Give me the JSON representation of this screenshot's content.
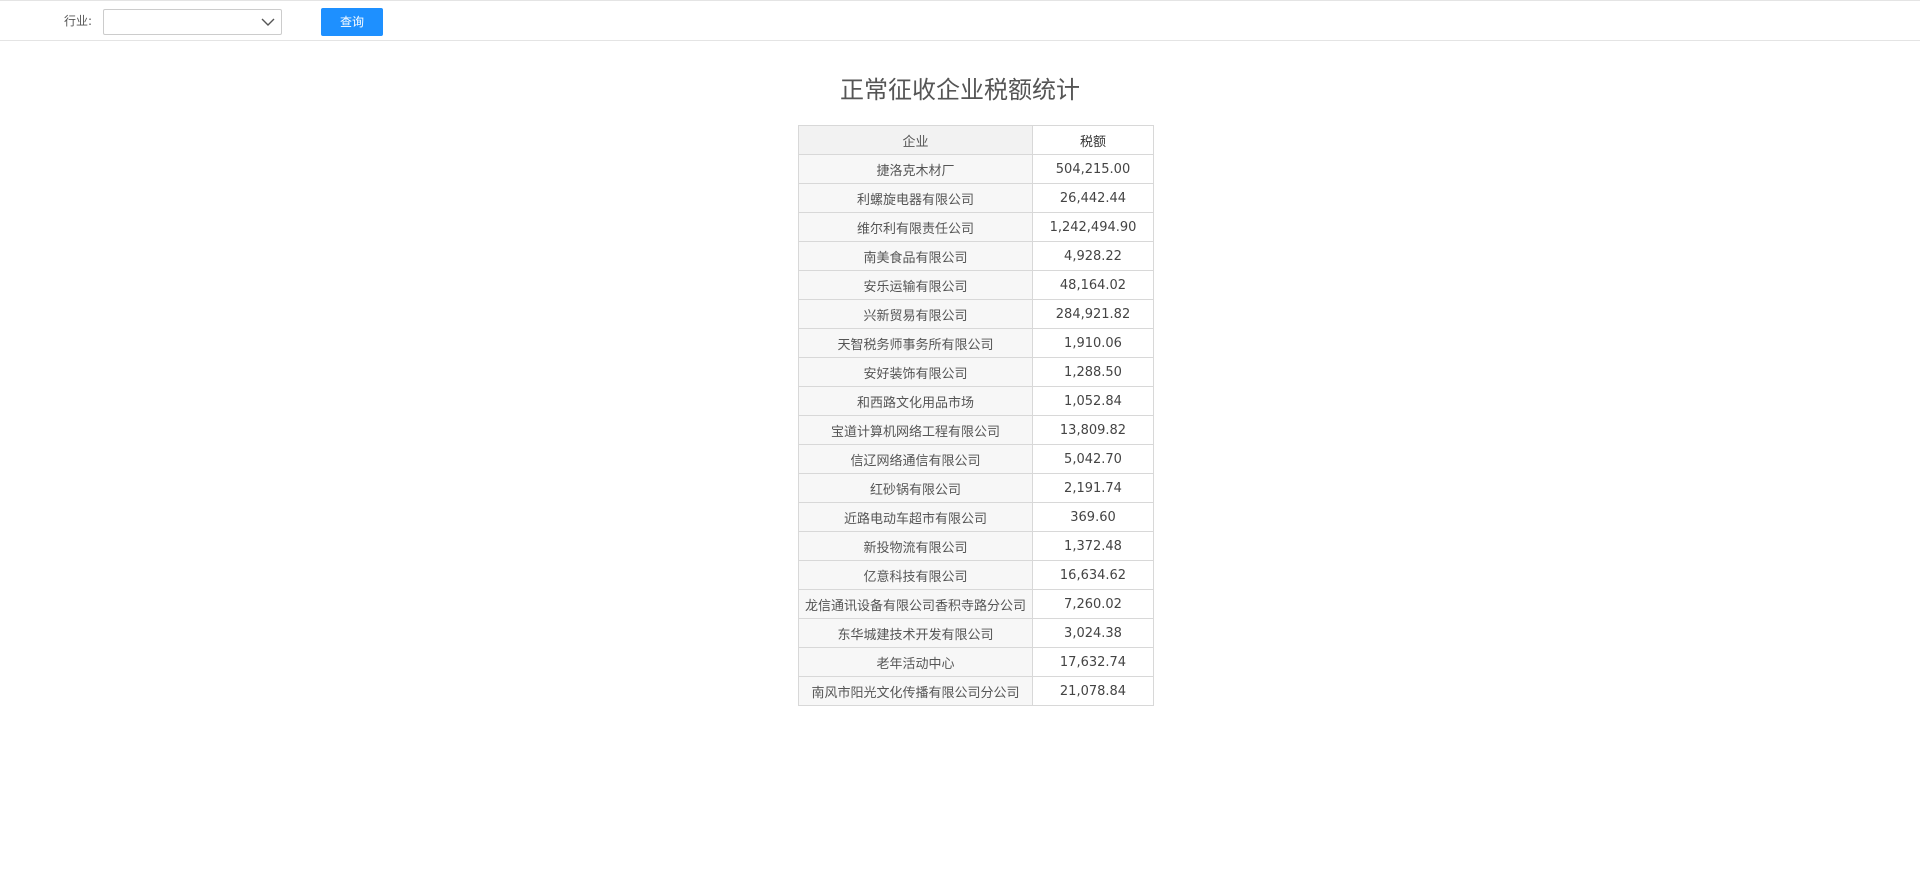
{
  "filter": {
    "industry_label": "行业:",
    "industry_value": "",
    "query_button": "查询"
  },
  "report": {
    "title": "正常征收企业税额统计",
    "columns": {
      "company": "企业",
      "tax": "税额"
    },
    "rows": [
      {
        "company": "捷洛克木材厂",
        "tax": "504,215.00"
      },
      {
        "company": "利螺旋电器有限公司",
        "tax": "26,442.44"
      },
      {
        "company": "维尔利有限责任公司",
        "tax": "1,242,494.90"
      },
      {
        "company": "南美食品有限公司",
        "tax": "4,928.22"
      },
      {
        "company": "安乐运输有限公司",
        "tax": "48,164.02"
      },
      {
        "company": "兴新贸易有限公司",
        "tax": "284,921.82"
      },
      {
        "company": "天智税务师事务所有限公司",
        "tax": "1,910.06"
      },
      {
        "company": "安好装饰有限公司",
        "tax": "1,288.50"
      },
      {
        "company": "和西路文化用品市场",
        "tax": "1,052.84"
      },
      {
        "company": "宝道计算机网络工程有限公司",
        "tax": "13,809.82"
      },
      {
        "company": "信辽网络通信有限公司",
        "tax": "5,042.70"
      },
      {
        "company": "红砂锅有限公司",
        "tax": "2,191.74"
      },
      {
        "company": "近路电动车超市有限公司",
        "tax": "369.60"
      },
      {
        "company": "新投物流有限公司",
        "tax": "1,372.48"
      },
      {
        "company": "亿意科技有限公司",
        "tax": "16,634.62"
      },
      {
        "company": "龙信通讯设备有限公司香积寺路分公司",
        "tax": "7,260.02"
      },
      {
        "company": "东华城建技术开发有限公司",
        "tax": "3,024.38"
      },
      {
        "company": "老年活动中心",
        "tax": "17,632.74"
      },
      {
        "company": "南风市阳光文化传播有限公司分公司",
        "tax": "21,078.84"
      }
    ]
  },
  "icons": {
    "dropdown": "chevron-down-icon"
  },
  "colors": {
    "primary_button": "#1e90ff",
    "border": "#d8d8d8",
    "text": "#555555"
  }
}
